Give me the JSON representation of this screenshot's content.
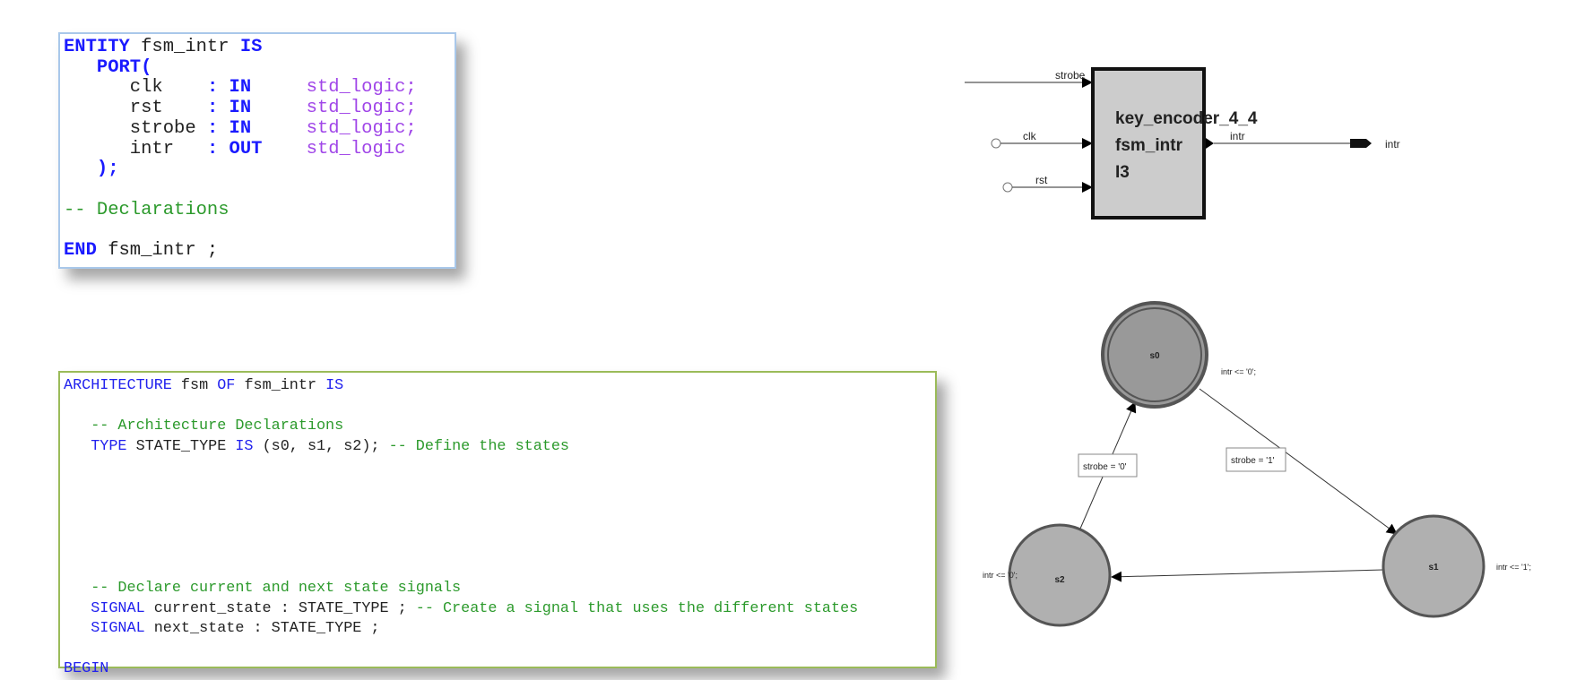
{
  "entity_code": {
    "lines": [
      [
        {
          "t": "ENTITY",
          "c": "kw"
        },
        {
          "t": " fsm_intr ",
          "c": "tx"
        },
        {
          "t": "IS",
          "c": "kw"
        }
      ],
      [
        {
          "t": "   PORT(",
          "c": "kw"
        }
      ],
      [
        {
          "t": "      clk    ",
          "c": "tx"
        },
        {
          "t": ": IN     ",
          "c": "kw"
        },
        {
          "t": "std_logic;",
          "c": "ty"
        }
      ],
      [
        {
          "t": "      rst    ",
          "c": "tx"
        },
        {
          "t": ": IN     ",
          "c": "kw"
        },
        {
          "t": "std_logic;",
          "c": "ty"
        }
      ],
      [
        {
          "t": "      strobe ",
          "c": "tx"
        },
        {
          "t": ": IN     ",
          "c": "kw"
        },
        {
          "t": "std_logic;",
          "c": "ty"
        }
      ],
      [
        {
          "t": "      intr   ",
          "c": "tx"
        },
        {
          "t": ": OUT    ",
          "c": "kw"
        },
        {
          "t": "std_logic",
          "c": "ty"
        }
      ],
      [
        {
          "t": "   );",
          "c": "kw"
        }
      ],
      [],
      [
        {
          "t": "-- Declarations",
          "c": "cm"
        }
      ],
      [],
      [
        {
          "t": "END",
          "c": "kw"
        },
        {
          "t": " fsm_intr ;",
          "c": "tx"
        }
      ]
    ]
  },
  "arch_code": {
    "lines": [
      [
        {
          "t": "ARCHITECTURE",
          "c": "kw"
        },
        {
          "t": " fsm ",
          "c": "tx"
        },
        {
          "t": "OF",
          "c": "kw"
        },
        {
          "t": " fsm_intr ",
          "c": "tx"
        },
        {
          "t": "IS",
          "c": "kw"
        }
      ],
      [],
      [
        {
          "t": "   -- Architecture Declarations",
          "c": "cm"
        }
      ],
      [
        {
          "t": "   TYPE",
          "c": "kw"
        },
        {
          "t": " STATE_TYPE ",
          "c": "tx"
        },
        {
          "t": "IS",
          "c": "kw"
        },
        {
          "t": " (s0, s1, s2); ",
          "c": "tx"
        },
        {
          "t": "-- Define the states",
          "c": "cm"
        }
      ],
      [],
      [],
      [],
      [],
      [],
      [],
      [
        {
          "t": "   -- Declare current and next state signals",
          "c": "cm"
        }
      ],
      [
        {
          "t": "   SIGNAL",
          "c": "kw"
        },
        {
          "t": " current_state : STATE_TYPE ; ",
          "c": "tx"
        },
        {
          "t": "-- Create a signal that uses the different states",
          "c": "cm"
        }
      ],
      [
        {
          "t": "   SIGNAL",
          "c": "kw"
        },
        {
          "t": " next_state : STATE_TYPE ;",
          "c": "tx"
        }
      ],
      [],
      [
        {
          "t": "BEGIN",
          "c": "kw"
        }
      ]
    ]
  },
  "block_diagram": {
    "inputs": [
      "strobe",
      "clk",
      "rst"
    ],
    "output": "intr",
    "output_port_label": "intr",
    "block_lines": [
      "key_encoder_4_4",
      "fsm_intr",
      "I3"
    ]
  },
  "state_diagram": {
    "states": [
      {
        "name": "s0",
        "action": "intr <= '0';",
        "initial": true
      },
      {
        "name": "s1",
        "action": "intr <= '1';"
      },
      {
        "name": "s2",
        "action": "intr <= '0';"
      }
    ],
    "transitions": [
      {
        "from": "s0",
        "to": "s1",
        "condition": "strobe = '1'"
      },
      {
        "from": "s2",
        "to": "s0",
        "condition": "strobe = '0'"
      },
      {
        "from": "s1",
        "to": "s2",
        "condition": ""
      }
    ],
    "colors": {
      "state_fill": "#b0b0b0",
      "initial_fill": "#999999",
      "stroke": "#555555"
    }
  }
}
